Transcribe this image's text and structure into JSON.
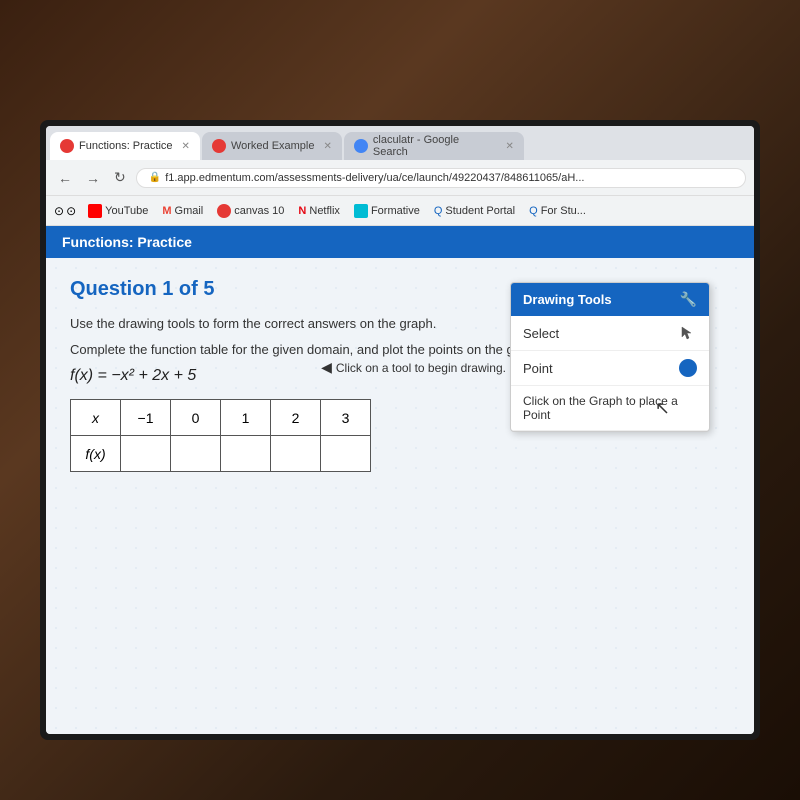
{
  "browser": {
    "tabs": [
      {
        "label": "Functions: Practice",
        "active": true,
        "icon_color": "#e53935"
      },
      {
        "label": "Worked Example",
        "active": false,
        "icon_color": "#e53935"
      },
      {
        "label": "claculatr - Google Search",
        "active": false,
        "icon_color": "#4285f4"
      }
    ],
    "url": "f1.app.edmentum.com/assessments-delivery/ua/ce/launch/49220437/848611065/aH...",
    "bookmarks": [
      {
        "label": "YouTube",
        "icon_color": "#ff0000"
      },
      {
        "label": "Gmail",
        "icon_color": "#ea4335"
      },
      {
        "label": "canvas 10",
        "icon_color": "#e53935"
      },
      {
        "label": "Netflix",
        "icon_color": "#e50914"
      },
      {
        "label": "Formative",
        "icon_color": "#00bcd4"
      },
      {
        "label": "Student Portal",
        "icon_color": "#1565c0"
      },
      {
        "label": "For Stu...",
        "icon_color": "#1565c0"
      }
    ]
  },
  "page": {
    "header_title": "Functions: Practice",
    "question_title": "Question 1 of 5",
    "instruction1": "Use the drawing tools to form the correct answers on the graph.",
    "instruction2": "Complete the function table for the given domain, and plot the points on the graph.",
    "equation_label": "f(x) =",
    "equation_body": " −x² + 2x + 5",
    "table": {
      "headers": [
        "x",
        "−1",
        "0",
        "1",
        "2",
        "3"
      ],
      "row_label": "f(x)",
      "values": [
        "",
        "",
        "",
        "",
        ""
      ]
    },
    "drawing_tools": {
      "panel_title": "Drawing Tools",
      "items": [
        {
          "label": "Select"
        },
        {
          "label": "Point"
        }
      ],
      "hint": "Click on the Graph to place a Point"
    },
    "tool_hint": "Click on a tool to begin drawing."
  }
}
